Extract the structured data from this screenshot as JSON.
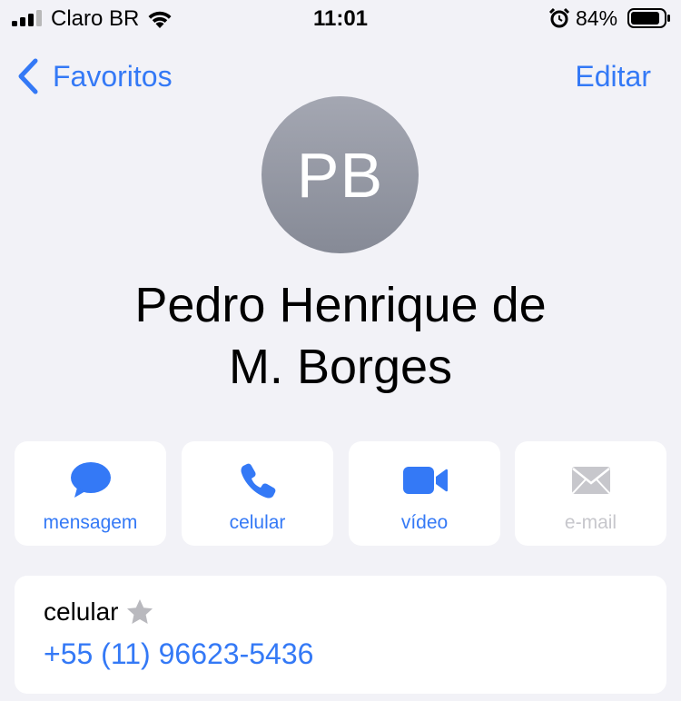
{
  "status_bar": {
    "carrier": "Claro BR",
    "time": "11:01",
    "battery": "84%",
    "icons": [
      "signal-icon",
      "wifi-icon",
      "alarm-icon",
      "battery-icon"
    ]
  },
  "nav": {
    "back_label": "Favoritos",
    "edit_label": "Editar"
  },
  "contact": {
    "initials": "PB",
    "name_line1": "Pedro Henrique de",
    "name_line2": "M. Borges"
  },
  "actions": [
    {
      "label": "mensagem",
      "icon": "message-icon",
      "enabled": true
    },
    {
      "label": "celular",
      "icon": "phone-icon",
      "enabled": true
    },
    {
      "label": "vídeo",
      "icon": "video-icon",
      "enabled": true
    },
    {
      "label": "e-mail",
      "icon": "mail-icon",
      "enabled": false
    }
  ],
  "phone": {
    "type": "celular",
    "number": "+55 (11) 96623-5436",
    "favorite_icon": "star-icon"
  },
  "colors": {
    "accent": "#3479f6",
    "background": "#f2f2f7",
    "card": "#ffffff",
    "disabled": "#c7c7cc"
  }
}
